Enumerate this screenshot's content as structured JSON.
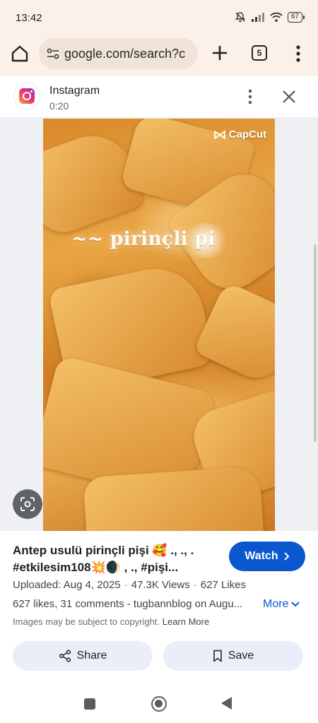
{
  "status_bar": {
    "time": "13:42",
    "battery": "67",
    "icons": [
      "bell-off-icon",
      "signal-icon",
      "wifi-icon",
      "battery-icon"
    ]
  },
  "toolbar": {
    "url": "google.com/search?c",
    "tab_count": "5",
    "icons": [
      "home-icon",
      "site-settings-icon",
      "new-tab-plus-icon",
      "tab-switcher-icon",
      "more-vert-icon"
    ]
  },
  "panel": {
    "source_name": "Instagram",
    "duration": "0:20",
    "icons": [
      "instagram-logo",
      "more-vert-icon",
      "close-icon"
    ]
  },
  "video": {
    "watermark": "CapCut",
    "overlay_text": "~~ pirinçli pi"
  },
  "info": {
    "title": "Antep usulü pirinçli pişi 🥰 ., ., . #etkilesim108💥🌒 , ., #pişi...",
    "watch_label": "Watch",
    "uploaded": "Uploaded: Aug 4, 2025",
    "views": "47.3K Views",
    "likes": "627 Likes",
    "description": "627 likes, 31 comments - tugbannblog on Augu...",
    "more_label": "More",
    "copyright": "Images may be subject to copyright.",
    "learn_more": "Learn More",
    "share_label": "Share",
    "save_label": "Save"
  },
  "colors": {
    "accent": "#0b57d0",
    "toolbar_bg": "#fbf1ea",
    "button_bg": "#e9eef8"
  }
}
